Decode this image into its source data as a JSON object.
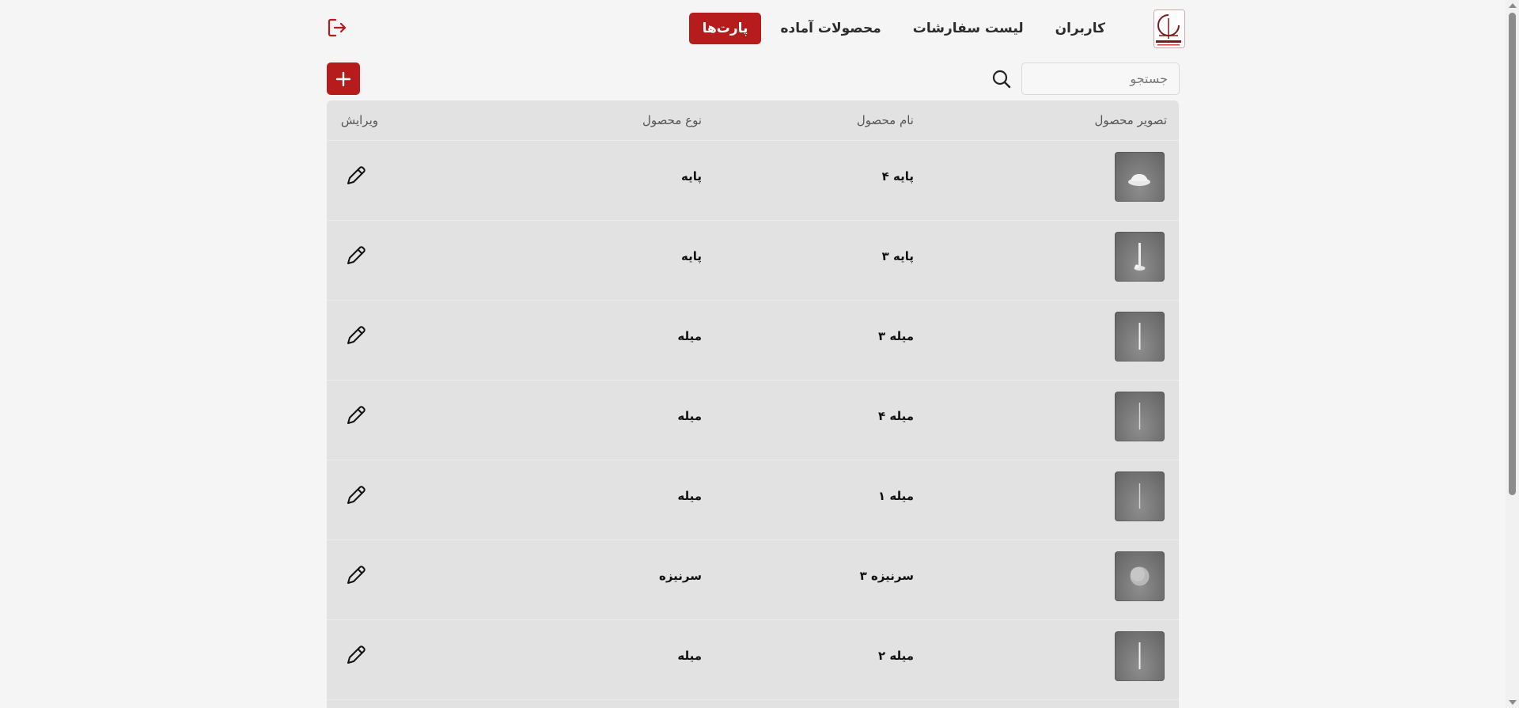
{
  "header": {
    "nav": [
      {
        "label": "کاربران",
        "active": false
      },
      {
        "label": "لیست سفارشات",
        "active": false
      },
      {
        "label": "محصولات آماده",
        "active": false
      },
      {
        "label": "پارت‌ها",
        "active": true
      }
    ],
    "logo_icon": "brand-logo",
    "logout_icon": "logout-icon"
  },
  "toolbar": {
    "search_placeholder": "جستجو",
    "search_icon": "search-icon",
    "add_icon": "plus-icon"
  },
  "table": {
    "columns": {
      "image": "تصویر محصول",
      "name": "نام محصول",
      "type": "نوع محصول",
      "edit": "ویرایش"
    },
    "rows": [
      {
        "name": "پایه ۴",
        "type": "پایه",
        "thumb": "base-wide"
      },
      {
        "name": "پایه ۳",
        "type": "پایه",
        "thumb": "base-tall"
      },
      {
        "name": "میله ۳",
        "type": "میله",
        "thumb": "rod"
      },
      {
        "name": "میله ۴",
        "type": "میله",
        "thumb": "rod"
      },
      {
        "name": "میله ۱",
        "type": "میله",
        "thumb": "rod"
      },
      {
        "name": "سرنیزه ۳",
        "type": "سرنیزه",
        "thumb": "ball"
      },
      {
        "name": "میله ۲",
        "type": "میله",
        "thumb": "rod"
      }
    ]
  },
  "colors": {
    "accent": "#b71c1c",
    "table_bg": "#e3e2e2",
    "page_bg": "#f5f5f5"
  }
}
